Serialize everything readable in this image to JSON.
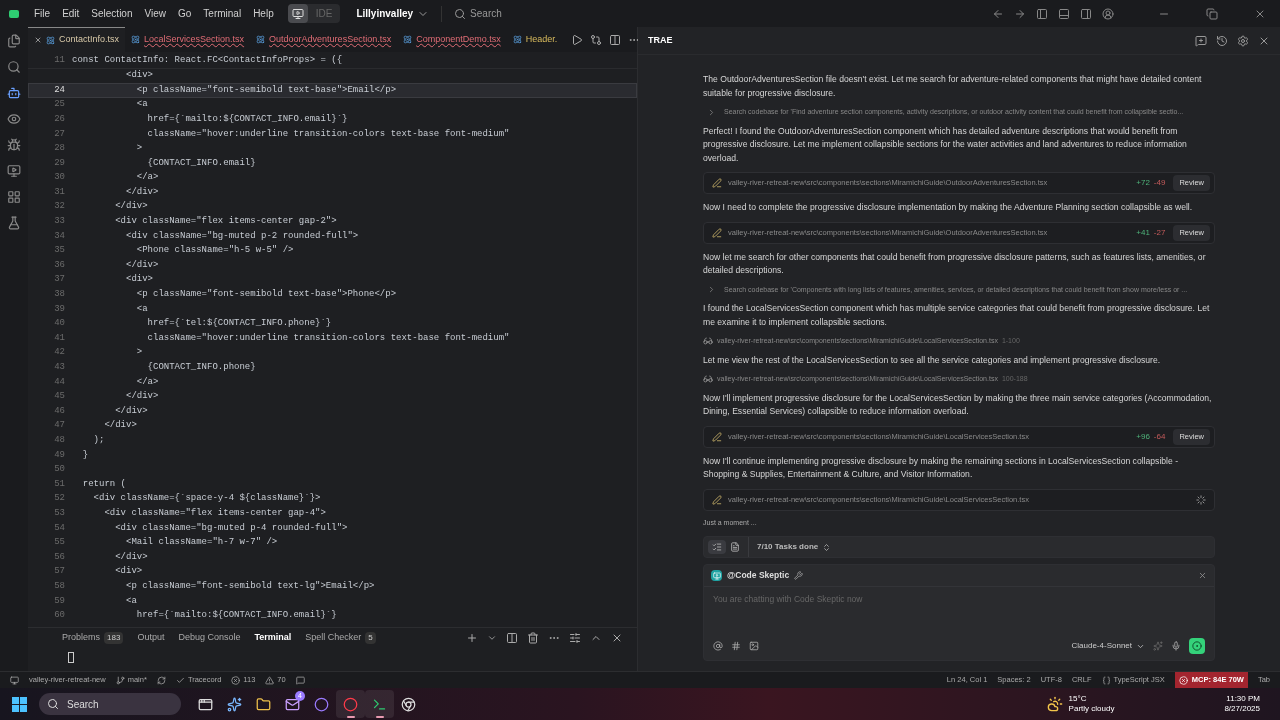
{
  "menu_bar": {
    "items": [
      "File",
      "Edit",
      "Selection",
      "View",
      "Go",
      "Terminal",
      "Help"
    ],
    "mode_label": "IDE",
    "project": "Lillyinvalley",
    "search_placeholder": "Search"
  },
  "editor": {
    "tabs": [
      {
        "label": "ContactInfo.tsx",
        "selected": true,
        "has_errors": false,
        "modified": false
      },
      {
        "label": "LocalServicesSection.tsx",
        "selected": false,
        "has_errors": true,
        "modified": false
      },
      {
        "label": "OutdoorAdventuresSection.tsx",
        "selected": false,
        "has_errors": true,
        "modified": false
      },
      {
        "label": "ComponentDemo.tsx",
        "selected": false,
        "has_errors": true,
        "modified": false
      },
      {
        "label": "Header.",
        "selected": false,
        "has_errors": false,
        "modified": true
      }
    ],
    "sticky_line": {
      "number": "11",
      "code": "const ContactInfo: React.FC<ContactInfoProps> = ({"
    },
    "lines": [
      {
        "code": "          <div>",
        "current": false
      },
      {
        "number": "24",
        "code": "            <p className=\"font-semibold text-base\">Email</p>",
        "current": true
      },
      {
        "number": "25",
        "code": "            <a",
        "current": false
      },
      {
        "number": "26",
        "code": "              href={`mailto:${CONTACT_INFO.email}`}",
        "current": false
      },
      {
        "number": "27",
        "code": "              className=\"hover:underline transition-colors text-base font-medium\"",
        "current": false
      },
      {
        "number": "28",
        "code": "            >",
        "current": false
      },
      {
        "number": "29",
        "code": "              {CONTACT_INFO.email}",
        "current": false
      },
      {
        "number": "30",
        "code": "            </a>",
        "current": false
      },
      {
        "number": "31",
        "code": "          </div>",
        "current": false
      },
      {
        "number": "32",
        "code": "        </div>",
        "current": false
      },
      {
        "number": "33",
        "code": "        <div className=\"flex items-center gap-2\">",
        "current": false
      },
      {
        "number": "34",
        "code": "          <div className=\"bg-muted p-2 rounded-full\">",
        "current": false
      },
      {
        "number": "35",
        "code": "            <Phone className=\"h-5 w-5\" />",
        "current": false
      },
      {
        "number": "36",
        "code": "          </div>",
        "current": false
      },
      {
        "number": "37",
        "code": "          <div>",
        "current": false
      },
      {
        "number": "38",
        "code": "            <p className=\"font-semibold text-base\">Phone</p>",
        "current": false
      },
      {
        "number": "39",
        "code": "            <a",
        "current": false
      },
      {
        "number": "40",
        "code": "              href={`tel:${CONTACT_INFO.phone}`}",
        "current": false
      },
      {
        "number": "41",
        "code": "              className=\"hover:underline transition-colors text-base font-medium\"",
        "current": false
      },
      {
        "number": "42",
        "code": "            >",
        "current": false
      },
      {
        "number": "43",
        "code": "              {CONTACT_INFO.phone}",
        "current": false
      },
      {
        "number": "44",
        "code": "            </a>",
        "current": false
      },
      {
        "number": "45",
        "code": "          </div>",
        "current": false
      },
      {
        "number": "46",
        "code": "        </div>",
        "current": false
      },
      {
        "number": "47",
        "code": "      </div>",
        "current": false
      },
      {
        "number": "48",
        "code": "    );",
        "current": false
      },
      {
        "number": "49",
        "code": "  }",
        "current": false
      },
      {
        "number": "50",
        "current": false
      },
      {
        "number": "51",
        "code": "  return (",
        "current": false
      },
      {
        "number": "52",
        "code": "    <div className={`space-y-4 ${className}`}>",
        "current": false
      },
      {
        "number": "53",
        "code": "      <div className=\"flex items-center gap-4\">",
        "current": false
      },
      {
        "number": "54",
        "code": "        <div className=\"bg-muted p-4 rounded-full\">",
        "current": false
      },
      {
        "number": "55",
        "code": "          <Mail className=\"h-7 w-7\" />",
        "current": false
      },
      {
        "number": "56",
        "code": "        </div>",
        "current": false
      },
      {
        "number": "57",
        "code": "        <div>",
        "current": false
      },
      {
        "number": "58",
        "code": "          <p className=\"font-semibold text-lg\">Email</p>",
        "current": false
      },
      {
        "number": "59",
        "code": "          <a",
        "current": false
      },
      {
        "number": "60",
        "code": "            href={`mailto:${CONTACT_INFO.email}`}",
        "current": false
      }
    ]
  },
  "panel": {
    "tabs": [
      {
        "label": "Problems",
        "count": "183",
        "selected": false
      },
      {
        "label": "Output",
        "selected": false
      },
      {
        "label": "Debug Console",
        "selected": false
      },
      {
        "label": "Terminal",
        "selected": true
      },
      {
        "label": "Spell Checker",
        "count": "5",
        "selected": false
      }
    ]
  },
  "status_bar": {
    "folder": "valley-river-retreat-new",
    "branch": "main*",
    "tracker": "Tracecord",
    "errors": "113",
    "warnings": "70",
    "position": "Ln 24, Col 1",
    "spaces": "Spaces: 2",
    "encoding": "UTF-8",
    "eol": "CRLF",
    "language": "TypeScript JSX",
    "mcp": "MCP: 84E 70W",
    "tab": "Tab"
  },
  "chat": {
    "title": "TRAE",
    "messages": [
      {
        "kind": "text",
        "text": "The OutdoorAdventuresSection file doesn't exist. Let me search for adventure-related components that might have detailed content suitable for progressive disclosure."
      },
      {
        "kind": "search",
        "text": "Search codebase for 'Find adventure section components, activity descriptions, or outdoor activity content that could benefit from collapsible sectio..."
      },
      {
        "kind": "text",
        "text": "Perfect! I found the OutdoorAdventuresSection component which has detailed adventure descriptions that would benefit from progressive disclosure. Let me implement collapsible sections for the water activities and land adventures to reduce information overload."
      },
      {
        "kind": "edit",
        "path": "valley-river-retreat-new\\src\\components\\sections\\MiramichiGuide\\OutdoorAdventuresSection.tsx",
        "added": "+72",
        "removed": "-49",
        "action": "Review"
      },
      {
        "kind": "text",
        "text": "Now I need to complete the progressive disclosure implementation by making the Adventure Planning section collapsible as well."
      },
      {
        "kind": "edit",
        "path": "valley-river-retreat-new\\src\\components\\sections\\MiramichiGuide\\OutdoorAdventuresSection.tsx",
        "added": "+41",
        "removed": "-27",
        "action": "Review"
      },
      {
        "kind": "text",
        "text": "Now let me search for other components that could benefit from progressive disclosure patterns, such as features lists, amenities, or detailed descriptions."
      },
      {
        "kind": "search",
        "text": "Search codebase for 'Components with long lists of features, amenities, services, or detailed descriptions that could benefit from show more/less or ..."
      },
      {
        "kind": "text",
        "text": "I found the LocalServicesSection component which has multiple service categories that could benefit from progressive disclosure. Let me examine it to implement collapsible sections."
      },
      {
        "kind": "view",
        "path": "valley-river-retreat-new\\src\\components\\sections\\MiramichiGuide\\LocalServicesSection.tsx",
        "range": "1-100"
      },
      {
        "kind": "text",
        "text": "Let me view the rest of the LocalServicesSection to see all the service categories and implement progressive disclosure."
      },
      {
        "kind": "view",
        "path": "valley-river-retreat-new\\src\\components\\sections\\MiramichiGuide\\LocalServicesSection.tsx",
        "range": "100-188"
      },
      {
        "kind": "text",
        "text": "Now I'll implement progressive disclosure for the LocalServicesSection by making the three main service categories (Accommodation, Dining, Essential Services) collapsible to reduce information overload."
      },
      {
        "kind": "edit",
        "path": "valley-river-retreat-new\\src\\components\\sections\\MiramichiGuide\\LocalServicesSection.tsx",
        "added": "+96",
        "removed": "-64",
        "action": "Review"
      },
      {
        "kind": "text",
        "text": "Now I'll continue implementing progressive disclosure by making the remaining sections in LocalServicesSection collapsible - Shopping & Supplies, Entertainment & Culture, and Visitor Information."
      },
      {
        "kind": "pending",
        "path": "valley-river-retreat-new\\src\\components\\sections\\MiramichiGuide\\LocalServicesSection.tsx"
      }
    ],
    "status": "Just a moment ...",
    "tasks": "7/10 Tasks done",
    "agent": "@Code Skeptic",
    "input_placeholder": "You are chatting with Code Skeptic now",
    "model": "Claude-4-Sonnet"
  },
  "taskbar": {
    "search": "Search",
    "apps": [
      {
        "kind": "windows",
        "selected": false
      },
      {
        "kind": "copilot",
        "selected": false
      },
      {
        "kind": "folder",
        "selected": false
      },
      {
        "kind": "mail",
        "badge": "4",
        "selected": false
      },
      {
        "kind": "purple",
        "selected": false
      },
      {
        "kind": "opera",
        "selected": true
      },
      {
        "kind": "terminal",
        "selected": true
      },
      {
        "kind": "chrome",
        "selected": false
      }
    ],
    "temperature": "15°C",
    "weather": "Partly cloudy",
    "time": "11:30 PM",
    "date": "8/27/2025"
  }
}
